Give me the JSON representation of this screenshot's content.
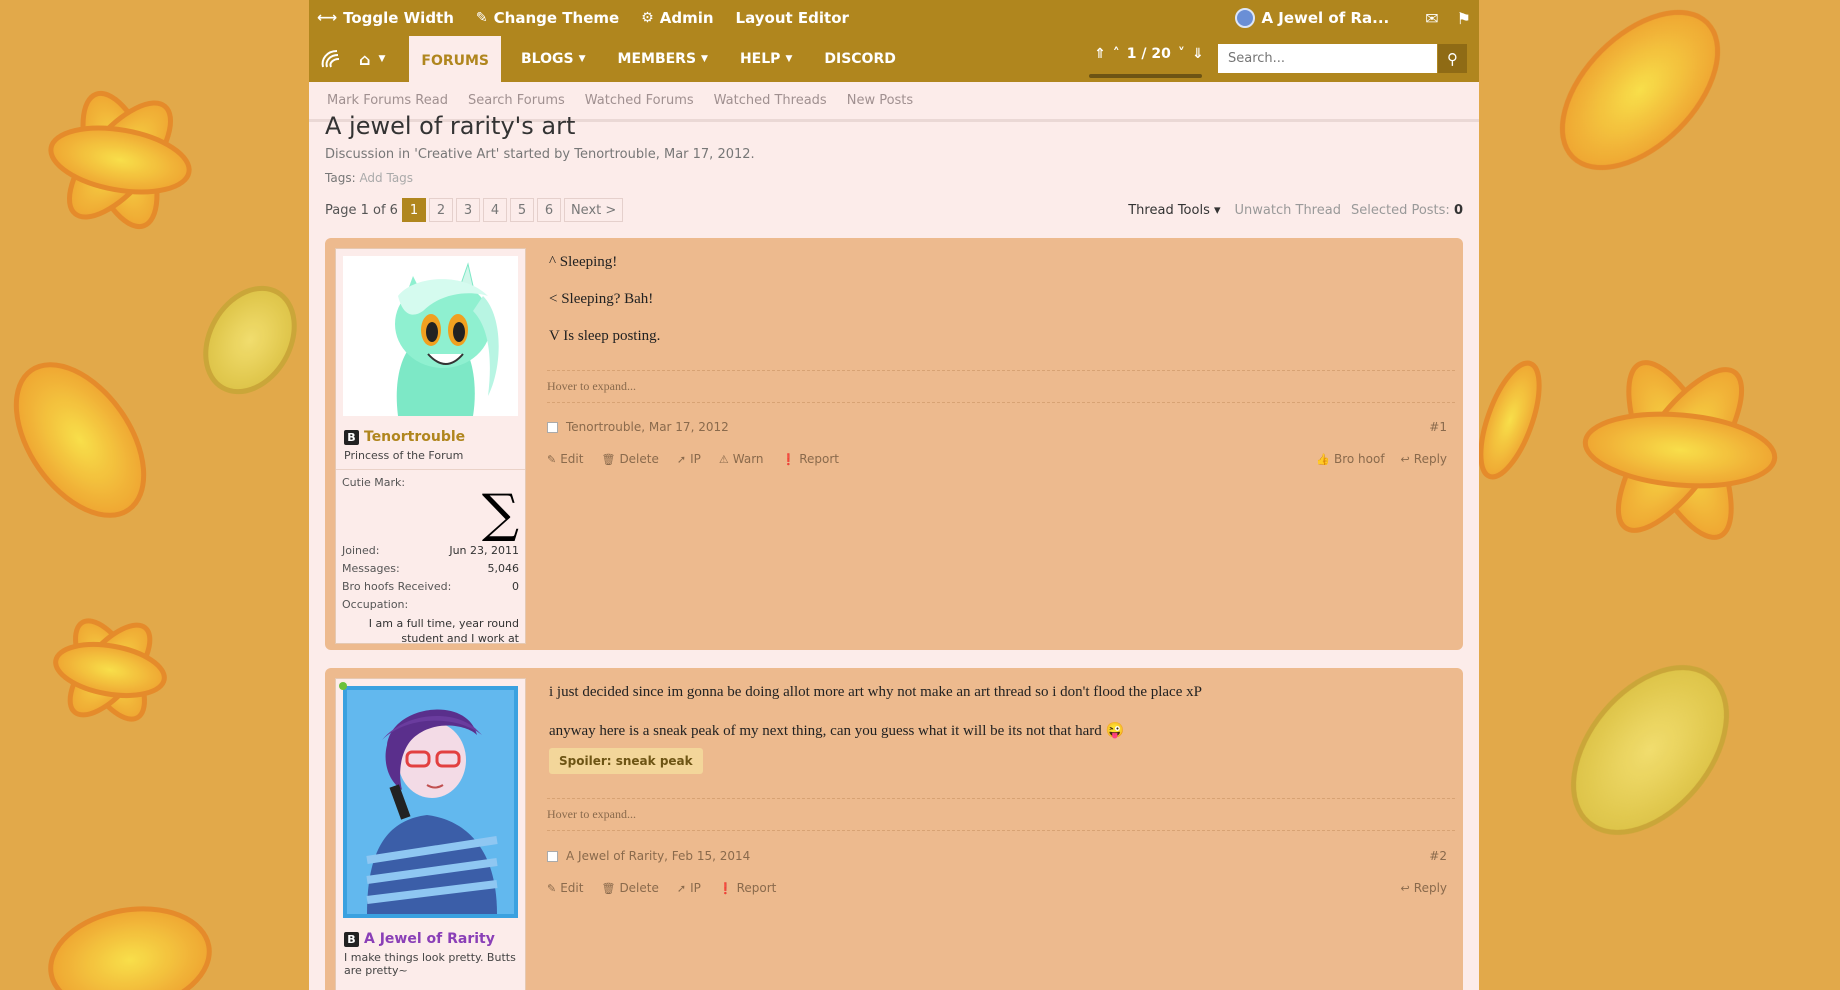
{
  "topbar": {
    "toggle_width": "Toggle Width",
    "change_theme": "Change Theme",
    "admin": "Admin",
    "layout_editor": "Layout Editor",
    "user_name": "A Jewel of Ra..."
  },
  "nav": {
    "forums": "FORUMS",
    "blogs": "BLOGS",
    "members": "MEMBERS",
    "help": "HELP",
    "discord": "DISCORD",
    "page_indicator": "1 / 20",
    "search_placeholder": "Search..."
  },
  "subnav": [
    "Mark Forums Read",
    "Search Forums",
    "Watched Forums",
    "Watched Threads",
    "New Posts"
  ],
  "thread": {
    "title": "A jewel of rarity's art",
    "meta": "Discussion in 'Creative Art' started by Tenortrouble, Mar 17, 2012.",
    "tags_label": "Tags:",
    "add_tags": "Add Tags",
    "page_label": "Page 1 of 6",
    "pages": [
      "1",
      "2",
      "3",
      "4",
      "5",
      "6"
    ],
    "next": "Next >",
    "thread_tools": "Thread Tools",
    "unwatch": "Unwatch Thread",
    "selected_label": "Selected Posts:",
    "selected_count": "0"
  },
  "posts": [
    {
      "user": {
        "name": "Tenortrouble",
        "title": "Princess of the Forum",
        "cutie_mark_label": "Cutie Mark:",
        "cutie_mark": "∑",
        "joined_label": "Joined:",
        "joined": "Jun 23, 2011",
        "messages_label": "Messages:",
        "messages": "5,046",
        "brohoofs_label": "Bro hoofs Received:",
        "brohoofs": "0",
        "occupation_label": "Occupation:",
        "occupation": "I am a full time, year round student and I work at"
      },
      "lines": [
        "^ Sleeping!",
        "< Sleeping? Bah!",
        "V Is sleep posting."
      ],
      "hover": "Hover to expand...",
      "author_date": "Tenortrouble, Mar 17, 2012",
      "number": "#1",
      "actions": [
        "Edit",
        "Delete",
        "IP",
        "Warn",
        "Report"
      ],
      "right_actions": [
        "Bro hoof",
        "Reply"
      ]
    },
    {
      "user": {
        "name": "A Jewel of Rarity",
        "title": "I make things look pretty. Butts are pretty~"
      },
      "lines": [
        "i just decided since im gonna be doing allot more art why not make an art thread so i don't flood the place xP",
        "anyway here is a sneak peak of my next thing, can you guess what it will be its not that hard"
      ],
      "spoiler": "Spoiler: sneak peak",
      "hover": "Hover to expand...",
      "author_date": "A Jewel of Rarity, Feb 15, 2014",
      "number": "#2",
      "actions": [
        "Edit",
        "Delete",
        "IP",
        "Report"
      ],
      "right_actions": [
        "Reply"
      ]
    }
  ]
}
